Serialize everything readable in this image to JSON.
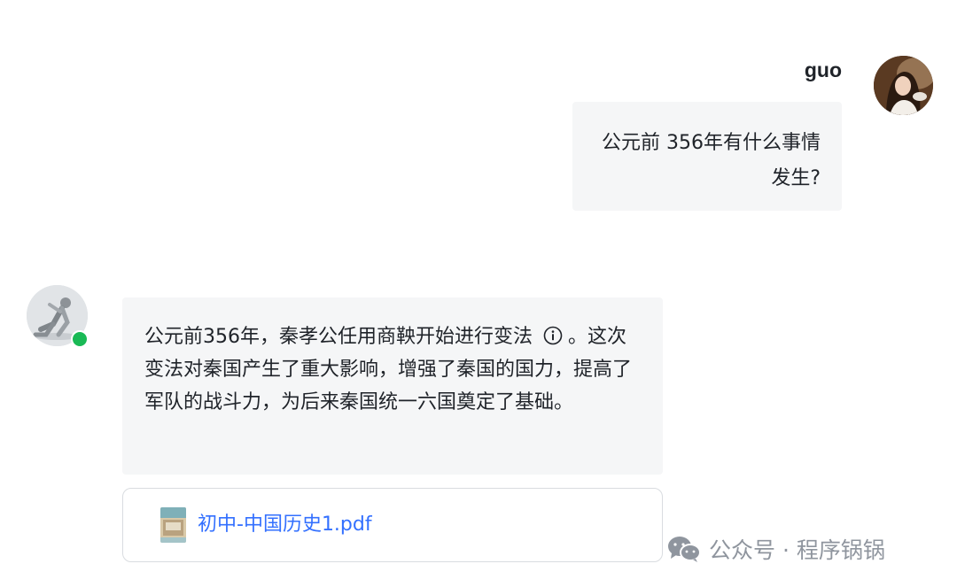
{
  "user_message": {
    "name": "guo",
    "avatar": "user-photo-avatar",
    "text": "公元前 356年有什么事情发生?"
  },
  "bot_message": {
    "avatar": "bot-figure-avatar",
    "status": "online",
    "status_color": "#19b955",
    "text_part1": "公元前356年，秦孝公任用商鞅开始进行变法",
    "citation_icon": "info-icon",
    "text_part2": "。这次变法对秦国产生了重大影响，增强了秦国的国力，提高了军队的战斗力，为后来秦国统一六国奠定了基础。",
    "attachment": {
      "icon": "pdf-thumbnail-icon",
      "file_name": "初中-中国历史1.pdf",
      "link_color": "#3370ff"
    }
  },
  "watermark": {
    "icon": "wechat-icon",
    "text": "公众号 · 程序锅锅"
  }
}
